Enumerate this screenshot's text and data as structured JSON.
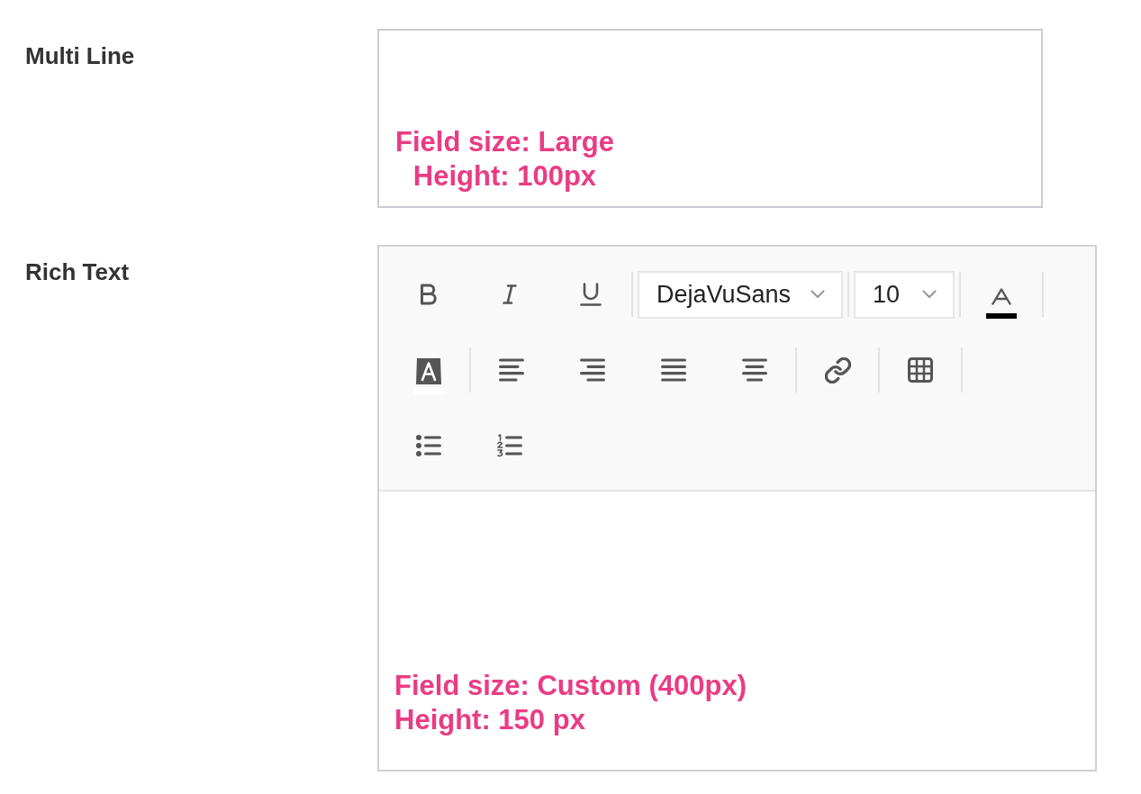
{
  "fields": [
    {
      "label": "Multi Line",
      "kind": "multiline",
      "annotation": [
        "Field size: Large",
        "Height: 100px"
      ]
    },
    {
      "label": "Rich Text",
      "kind": "richtext",
      "toolbar": {
        "groups": [
          {
            "items": [
              {
                "kind": "bold"
              },
              {
                "kind": "italic"
              },
              {
                "kind": "underline"
              }
            ]
          },
          {
            "items": [
              {
                "kind": "font",
                "value": "DejaVuSans"
              }
            ]
          },
          {
            "items": [
              {
                "kind": "size",
                "value": "10"
              }
            ]
          },
          {
            "items": [
              {
                "kind": "textcolor",
                "color": "#000000"
              }
            ]
          },
          {
            "items": [
              {
                "kind": "highlight",
                "color": "#ffffff"
              }
            ]
          },
          {
            "items": [
              {
                "kind": "alignleft"
              },
              {
                "kind": "alignright"
              },
              {
                "kind": "justify"
              },
              {
                "kind": "aligncenter"
              }
            ]
          },
          {
            "items": [
              {
                "kind": "link"
              }
            ]
          },
          {
            "items": [
              {
                "kind": "table"
              }
            ]
          },
          {
            "items": [
              {
                "kind": "bullets"
              },
              {
                "kind": "numbering"
              }
            ]
          }
        ]
      },
      "annotation": [
        "Field size: Custom (400px)",
        "Height: 150 px"
      ]
    }
  ]
}
